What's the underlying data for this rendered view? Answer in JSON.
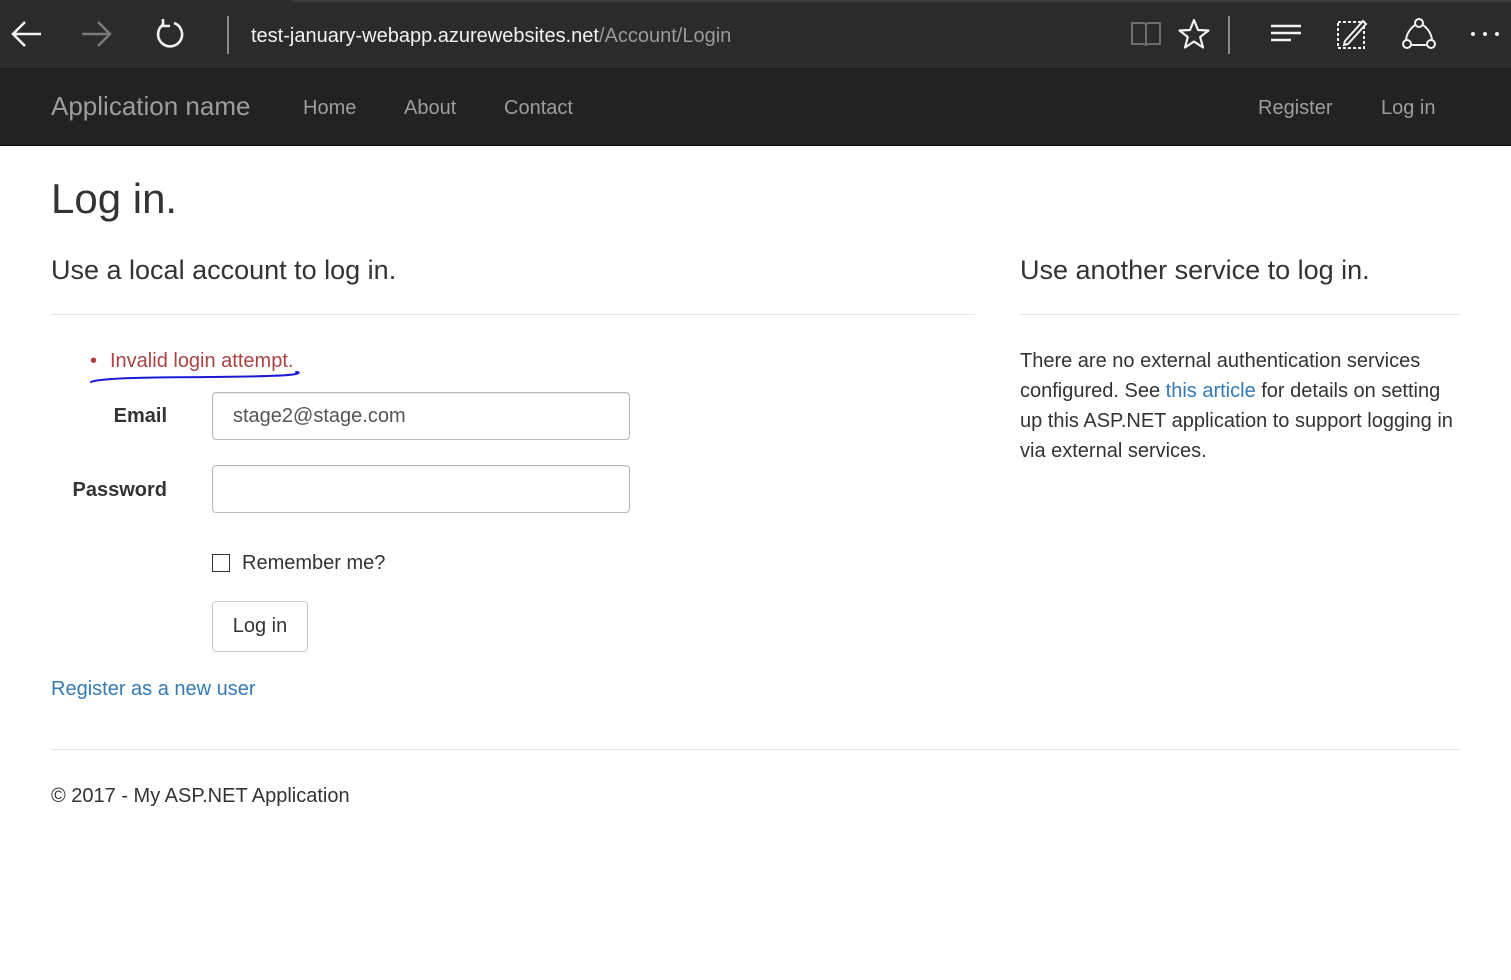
{
  "browser": {
    "url_host": "test-january-webapp.azurewebsites.net",
    "url_path": "/Account/Login",
    "icons": [
      "back-icon",
      "forward-icon",
      "refresh-icon",
      "reading-view-icon",
      "favorite-star-icon",
      "hub-icon",
      "web-note-icon",
      "share-icon",
      "more-icon"
    ]
  },
  "navbar": {
    "brand": "Application name",
    "links": [
      "Home",
      "About",
      "Contact"
    ],
    "right_links": [
      "Register",
      "Log in"
    ]
  },
  "page": {
    "title": "Log in.",
    "local_heading": "Use a local account to log in.",
    "external_heading": "Use another service to log in."
  },
  "form": {
    "error": "Invalid login attempt.",
    "bullet": "•",
    "email_label": "Email",
    "email_value": "stage2@stage.com",
    "password_label": "Password",
    "password_value": "",
    "remember_label": "Remember me?",
    "remember_checked": false,
    "submit_label": "Log in",
    "register_link": "Register as a new user"
  },
  "external": {
    "text_before": "There are no external authentication services configured. See ",
    "link": "this article",
    "text_after": " for details on setting up this ASP.NET application to support logging in via external services."
  },
  "footer": {
    "text": "© 2017 - My ASP.NET Application"
  },
  "colors": {
    "chrome_bg": "#2b2b2b",
    "navbar_bg": "#222222",
    "nav_text": "#9d9d9d",
    "error": "#a94442",
    "link": "#337ab7",
    "annotation": "#1a1ad6"
  }
}
